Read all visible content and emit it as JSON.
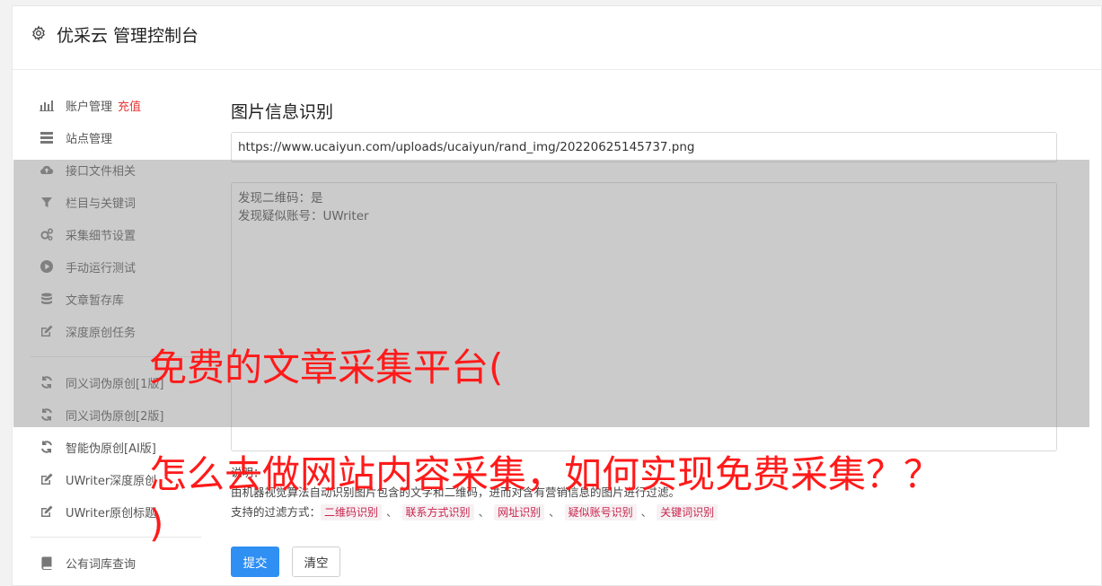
{
  "header": {
    "title": "优采云 管理控制台"
  },
  "sidebar": {
    "items": [
      {
        "label": "账户管理",
        "badge": "充值"
      },
      {
        "label": "站点管理"
      },
      {
        "label": "接口文件相关"
      },
      {
        "label": "栏目与关键词"
      },
      {
        "label": "采集细节设置"
      },
      {
        "label": "手动运行测试"
      },
      {
        "label": "文章暂存库"
      },
      {
        "label": "深度原创任务"
      },
      {
        "label": "同义词伪原创[1版]"
      },
      {
        "label": "同义词伪原创[2版]"
      },
      {
        "label": "智能伪原创[AI版]"
      },
      {
        "label": "UWriter深度原创"
      },
      {
        "label": "UWriter原创标题"
      },
      {
        "label": "公有词库查询"
      }
    ]
  },
  "main": {
    "title": "图片信息识别",
    "url_value": "https://www.ucaiyun.com/uploads/ucaiyun/rand_img/20220625145737.png",
    "result_lines": [
      "发现二维码：是",
      "发现疑似账号：UWriter"
    ],
    "note_label": "说明：",
    "note_desc": "由机器视觉算法自动识别图片包含的文字和二维码，进而对含有营销信息的图片进行过滤。",
    "filter_label": "支持的过滤方式：",
    "filters": [
      "二维码识别",
      "联系方式识别",
      "网址识别",
      "疑似账号识别",
      "关键词识别"
    ],
    "filter_sep": "、",
    "submit_label": "提交",
    "clear_label": "清空"
  },
  "overlay_text": {
    "line1": "免费的文章采集平台(",
    "line2": "怎么去做网站内容采集，如何实现免费采集？？",
    "line3": ")"
  }
}
